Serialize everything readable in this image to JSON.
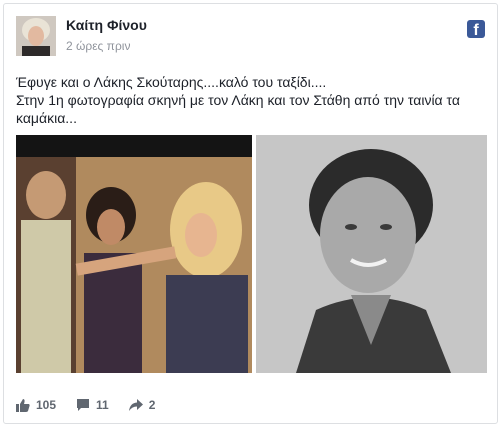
{
  "post": {
    "author_name": "Καίτη Φίνου",
    "timestamp": "2 ώρες πριν",
    "text_lines": [
      "Έφυγε και ο Λάκης Σκούταρης....καλό του ταξίδι....",
      "Στην 1η φωτογραφία σκηνή με τον Λάκη και τον Στάθη από την ταινία τα καμάκια..."
    ]
  },
  "stats": {
    "likes": "105",
    "comments": "11",
    "shares": "2"
  },
  "icons": {
    "brand": "facebook-icon",
    "like": "thumbs-up-icon",
    "comment": "comment-icon",
    "share": "share-arrow-icon"
  },
  "colors": {
    "brand_blue": "#3b5998",
    "meta_gray": "#90949c",
    "action_gray": "#606770",
    "border": "#dddfe2"
  }
}
